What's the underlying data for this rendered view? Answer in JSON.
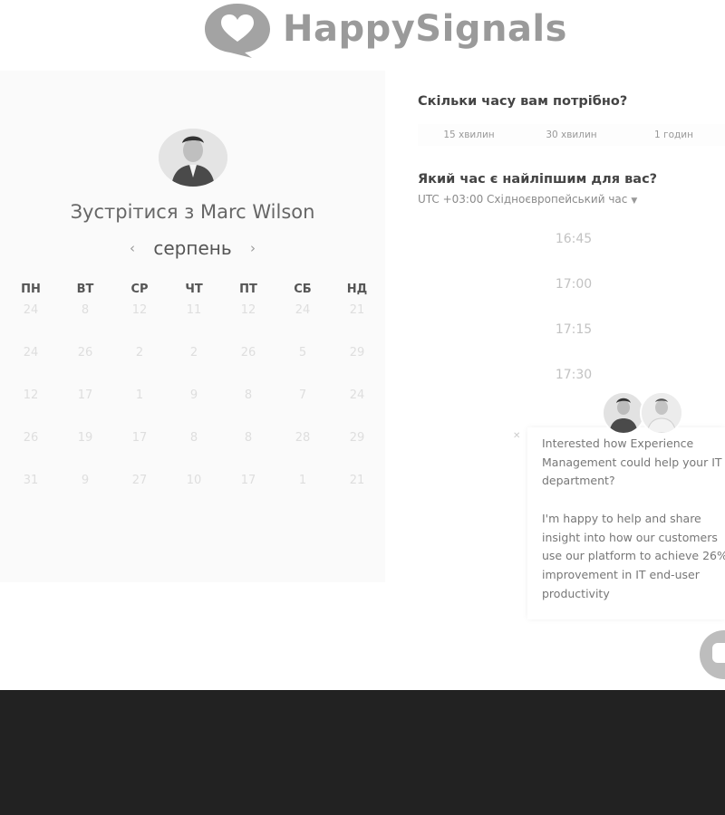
{
  "brand": {
    "name": "HappySignals"
  },
  "booking": {
    "title": "Зустрітися з Marc Wilson",
    "month": "серпень",
    "prev_icon": "chevron-left-icon",
    "next_icon": "chevron-right-icon",
    "weekdays": [
      "ПН",
      "ВТ",
      "СР",
      "ЧТ",
      "ПТ",
      "СБ",
      "НД"
    ],
    "weeks": [
      [
        "24",
        "8",
        "12",
        "11",
        "12",
        "24",
        "21"
      ],
      [
        "24",
        "26",
        "2",
        "2",
        "26",
        "5",
        "29"
      ],
      [
        "12",
        "17",
        "1",
        "9",
        "8",
        "7",
        "24"
      ],
      [
        "26",
        "19",
        "17",
        "8",
        "8",
        "28",
        "29"
      ],
      [
        "31",
        "9",
        "27",
        "10",
        "17",
        "1",
        "21"
      ]
    ]
  },
  "duration": {
    "question": "Скільки часу вам потрібно?",
    "options": [
      "15 хвилин",
      "30 хвилин",
      "1 годин"
    ]
  },
  "time": {
    "question": "Який час є найліпшим для вас?",
    "timezone": "UTC +03:00 Східноєвропейський час",
    "slots": [
      "16:45",
      "17:00",
      "17:15",
      "17:30"
    ]
  },
  "chat": {
    "message": "Interested how Experience\nManagement could help your IT\ndepartment?\n\nI'm happy to help and share\ninsight into how our customers\nuse our platform to achieve 26%\nimprovement in IT end-user\nproductivity",
    "close_label": "✕"
  }
}
